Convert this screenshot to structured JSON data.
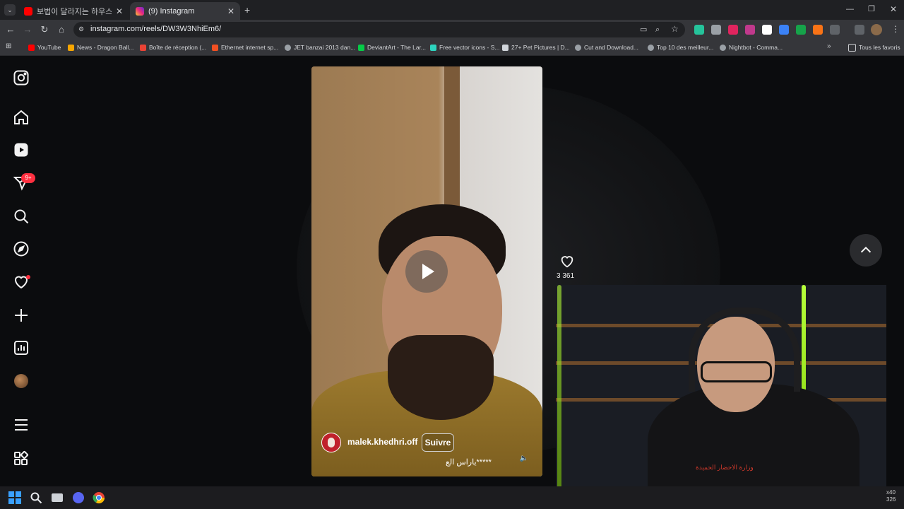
{
  "browser": {
    "tabs": [
      {
        "title": "보법이 달라지는 하우스 - YouTube",
        "active": false
      },
      {
        "title": "(9) Instagram",
        "active": true
      }
    ],
    "new_tab_label": "+",
    "url": "instagram.com/reels/DW3W3NhiEm6/",
    "bookmarks": [
      "YouTube",
      "News - Dragon Ball...",
      "Boîte de réception (...",
      "Ethernet internet sp...",
      "JET banzai 2013 dan...",
      "DeviantArt - The Lar...",
      "Free vector icons - S...",
      "27+ Pet Pictures | D...",
      "Cut and Download...",
      "Top 10 des meilleur...",
      "Nightbot - Comma..."
    ],
    "bookmarks_more": "»",
    "all_bookmarks": "Tous les favoris"
  },
  "sidebar": {
    "notification_badge": "9+"
  },
  "reel": {
    "username": "malek.khedhri.off",
    "follow_label": "Suivre",
    "caption": "ياراس الع*****",
    "like_count": "3 361"
  },
  "webcam": {
    "shirt_text": "وزارة الاحضار الحميدة"
  },
  "corner_text": [
    "x40",
    "326"
  ],
  "colors": {
    "accent": "#ff3040",
    "page_bg": "#0b0c0e",
    "chrome_bg": "#35363a"
  }
}
